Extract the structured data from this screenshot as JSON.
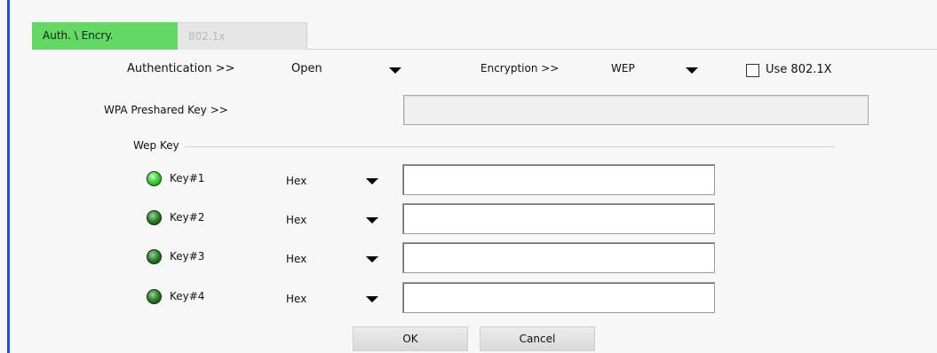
{
  "tabs": [
    {
      "label": "Auth. \\ Encry.",
      "active": true
    },
    {
      "label": "802.1x",
      "active": false
    }
  ],
  "auth": {
    "label": "Authentication >>",
    "value": "Open",
    "encryption_label": "Encryption >>",
    "encryption_value": "WEP",
    "use8021x_label": "Use 802.1X",
    "use8021x_checked": false
  },
  "wpa": {
    "label": "WPA Preshared Key >>",
    "value": ""
  },
  "wep": {
    "group_label": "Wep Key",
    "keys": [
      {
        "label": "Key#1",
        "format": "Hex",
        "value": "",
        "selected": true
      },
      {
        "label": "Key#2",
        "format": "Hex",
        "value": "",
        "selected": false
      },
      {
        "label": "Key#3",
        "format": "Hex",
        "value": "",
        "selected": false
      },
      {
        "label": "Key#4",
        "format": "Hex",
        "value": "",
        "selected": false
      }
    ]
  },
  "buttons": {
    "ok": "OK",
    "cancel": "Cancel"
  },
  "colors": {
    "tab_active": "#64d864",
    "accent": "#1f4fd6",
    "led": "#2e9a28"
  }
}
